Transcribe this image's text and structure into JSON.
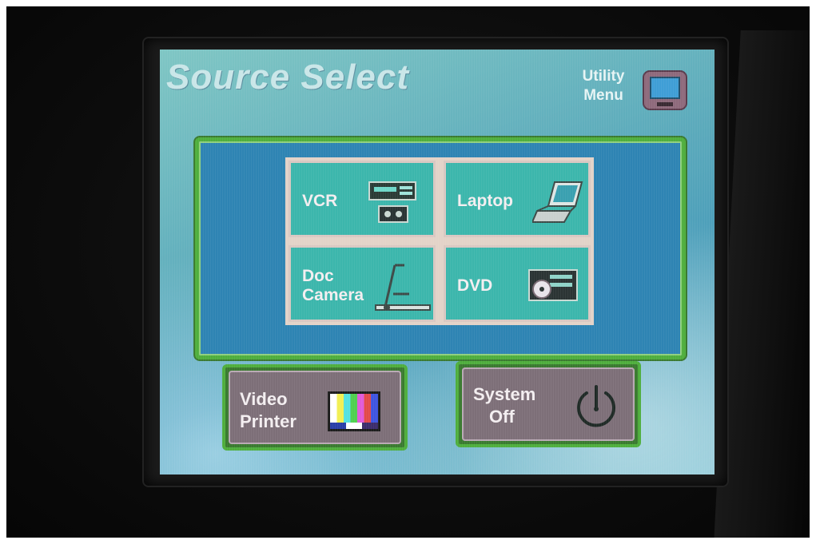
{
  "screen": {
    "title": "Source Select",
    "utility_menu": {
      "line1": "Utility",
      "line2": "Menu",
      "icon": "monitor-icon"
    }
  },
  "sources": [
    {
      "label": "VCR",
      "icon": "vcr-icon"
    },
    {
      "label": "Laptop",
      "icon": "laptop-icon"
    },
    {
      "label_line1": "Doc",
      "label_line2": "Camera",
      "icon": "document-camera-icon"
    },
    {
      "label": "DVD",
      "icon": "dvd-player-icon"
    }
  ],
  "actions": {
    "video_printer": {
      "line1": "Video",
      "line2": "Printer",
      "icon": "color-bars-icon"
    },
    "system_off": {
      "line1": "System",
      "line2": "Off",
      "icon": "power-icon"
    }
  },
  "colors": {
    "panel_border": "#4fae3d",
    "panel_fill": "#2e84b3",
    "source_button": "#3cb6ac",
    "action_button": "#7d6f78"
  }
}
